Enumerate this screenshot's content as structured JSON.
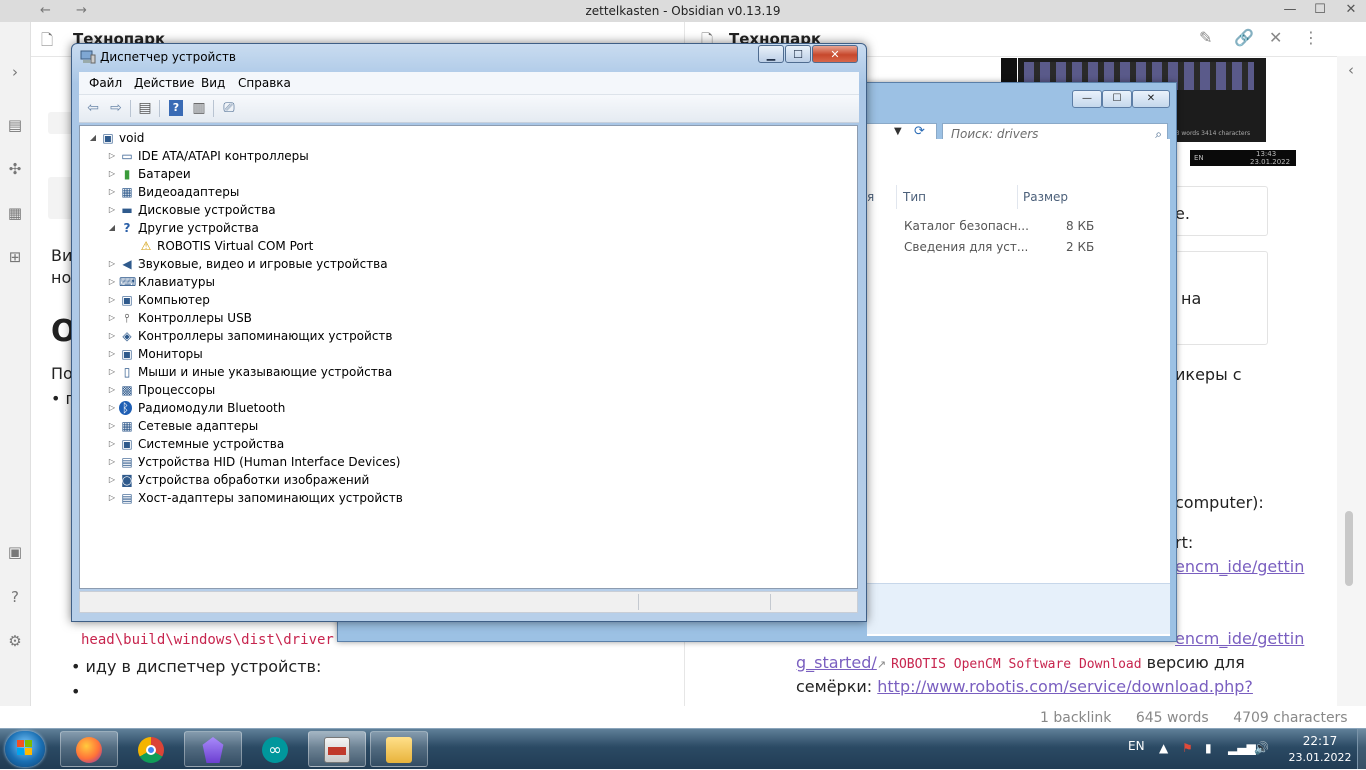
{
  "obsidian": {
    "window_title": "zettelkasten - Obsidian v0.13.19",
    "left_pane": {
      "title": "Технопарк",
      "lines": [
        "Ви",
        "но",
        "О",
        "По",
        "• п"
      ],
      "code_line1": "head\\build\\windows\\dist\\driver",
      "bullet1": "иду в диспетчер устройств:",
      "bullet2": "•"
    },
    "right_pane": {
      "title": "Технопарк",
      "frag1": "е.",
      "frag2": "на",
      "frag3": "икеры с",
      "frag4": "computer):",
      "frag5": "rt:",
      "link1": "encm_ide/gettin",
      "link2": "encm_ide/gettin",
      "line_link_start": "g_started/",
      "code_text": "ROBOTIS OpenCM Software Download",
      "line_tail": "версию для",
      "line2_prefix": "семёрки:",
      "line2_link": "http://www.robotis.com/service/download.php?"
    },
    "status": {
      "backlinks": "1 backlink",
      "words": "645 words",
      "characters": "4709 characters"
    }
  },
  "explorer": {
    "search_placeholder": "Поиск: drivers",
    "columns": {
      "name_fragment": "я",
      "type": "Тип",
      "size": "Размер"
    },
    "rows": [
      {
        "type": "Каталог безопасн...",
        "size": "8 КБ"
      },
      {
        "type": "Сведения для уст...",
        "size": "2 КБ"
      }
    ]
  },
  "device_manager": {
    "title": "Диспетчер устройств",
    "menu": [
      "Файл",
      "Действие",
      "Вид",
      "Справка"
    ],
    "root": "void",
    "categories": [
      {
        "label": "IDE ATA/ATAPI контроллеры",
        "icon": "ide-controller-icon",
        "expanded": false
      },
      {
        "label": "Батареи",
        "icon": "battery-icon",
        "expanded": false
      },
      {
        "label": "Видеоадаптеры",
        "icon": "display-adapter-icon",
        "expanded": false
      },
      {
        "label": "Дисковые устройства",
        "icon": "disk-drive-icon",
        "expanded": false
      },
      {
        "label": "Другие устройства",
        "icon": "other-devices-icon",
        "expanded": true,
        "children": [
          {
            "label": "ROBOTIS Virtual COM Port",
            "icon": "warning-device-icon"
          }
        ]
      },
      {
        "label": "Звуковые, видео и игровые устройства",
        "icon": "sound-icon",
        "expanded": false
      },
      {
        "label": "Клавиатуры",
        "icon": "keyboard-icon",
        "expanded": false
      },
      {
        "label": "Компьютер",
        "icon": "computer-icon",
        "expanded": false
      },
      {
        "label": "Контроллеры USB",
        "icon": "usb-icon",
        "expanded": false
      },
      {
        "label": "Контроллеры запоминающих устройств",
        "icon": "storage-controller-icon",
        "expanded": false
      },
      {
        "label": "Мониторы",
        "icon": "monitor-icon",
        "expanded": false
      },
      {
        "label": "Мыши и иные указывающие устройства",
        "icon": "mouse-icon",
        "expanded": false
      },
      {
        "label": "Процессоры",
        "icon": "processor-icon",
        "expanded": false
      },
      {
        "label": "Радиомодули Bluetooth",
        "icon": "bluetooth-icon",
        "expanded": false
      },
      {
        "label": "Сетевые адаптеры",
        "icon": "network-adapter-icon",
        "expanded": false
      },
      {
        "label": "Системные устройства",
        "icon": "system-devices-icon",
        "expanded": false
      },
      {
        "label": "Устройства HID (Human Interface Devices)",
        "icon": "hid-icon",
        "expanded": false
      },
      {
        "label": "Устройства обработки изображений",
        "icon": "imaging-device-icon",
        "expanded": false
      },
      {
        "label": "Хост-адаптеры запоминающих устройств",
        "icon": "storage-host-icon",
        "expanded": false
      }
    ]
  },
  "taskbar": {
    "items": [
      "firefox-icon",
      "chrome-icon",
      "obsidian-icon",
      "arduino-icon",
      "device-manager-icon",
      "explorer-icon"
    ],
    "language": "EN",
    "time": "22:17",
    "date": "23.01.2022"
  },
  "thumbnail": {
    "status_text": "463 words 3414 characters",
    "clock_time": "13:43",
    "clock_date": "23.01.2022",
    "language": "EN"
  }
}
